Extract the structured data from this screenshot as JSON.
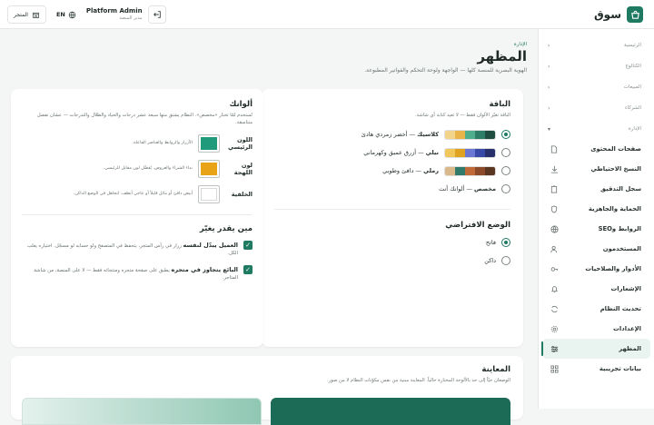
{
  "app": {
    "name": "سوق"
  },
  "topbar": {
    "user_name": "Platform Admin",
    "user_role": "مدير المنصة",
    "lang": "EN",
    "store_button": "المتجر"
  },
  "sidebar": {
    "sections": [
      {
        "label": "الرئيسية"
      },
      {
        "label": "الكتالوج"
      },
      {
        "label": "المبيعات"
      },
      {
        "label": "الشركاء"
      },
      {
        "label": "الإدارة"
      }
    ],
    "items": [
      {
        "label": "صفحات المحتوى",
        "icon": "file-icon"
      },
      {
        "label": "النسخ الاحتياطي",
        "icon": "download-icon"
      },
      {
        "label": "سجل التدقيق",
        "icon": "clipboard-icon"
      },
      {
        "label": "الحماية والجاهزية",
        "icon": "shield-icon"
      },
      {
        "label": "الروابط وSEO",
        "icon": "globe-icon"
      },
      {
        "label": "المستخدمون",
        "icon": "users-icon"
      },
      {
        "label": "الأدوار والصلاحيات",
        "icon": "key-icon"
      },
      {
        "label": "الإشعارات",
        "icon": "bell-icon"
      },
      {
        "label": "تحديث النظام",
        "icon": "refresh-icon"
      },
      {
        "label": "الإعدادات",
        "icon": "gear-icon"
      },
      {
        "label": "المظهر",
        "icon": "sliders-icon",
        "active": true
      },
      {
        "label": "بيانات تجريبية",
        "icon": "grid-icon"
      }
    ]
  },
  "page": {
    "breadcrumb": "الإدارة",
    "title": "المظهر",
    "subtitle": "الهوية البصرية للمنصة كلها — الواجهة ولوحة التحكم والفواتير المطبوعة."
  },
  "package": {
    "title": "الباقة",
    "hint": "الباقة تغيّر الألوان فقط — لا تعيد كتابة أي شاشة.",
    "options": [
      {
        "label": "كلاسيك",
        "desc": "أخضر زمردي هادئ",
        "selected": true,
        "colors": [
          "#1f4d40",
          "#2e7d66",
          "#4fae8c",
          "#e9b54a",
          "#f2d48a"
        ]
      },
      {
        "label": "نيلي",
        "desc": "أزرق عميق وكهرماني",
        "selected": false,
        "colors": [
          "#27306b",
          "#3849a8",
          "#6a78d4",
          "#e0a320",
          "#f2c75a"
        ]
      },
      {
        "label": "رملي",
        "desc": "دافئ وطوبي",
        "selected": false,
        "colors": [
          "#5a3520",
          "#8b4a2a",
          "#c06a3a",
          "#2f7a6a",
          "#d9b98a"
        ]
      },
      {
        "label": "مخصص",
        "desc": "ألوانك أنت",
        "selected": false,
        "colors": []
      }
    ]
  },
  "mode": {
    "title": "الوضع الافتراضي",
    "options": [
      {
        "label": "فاتح",
        "selected": true
      },
      {
        "label": "داكن",
        "selected": false
      }
    ]
  },
  "colors_card": {
    "title": "ألوانك",
    "hint": "تُستخدم لمّا تختار «مخصص». النظام يشتق منها سبعة عشر درجات والحياد والظلال والتدرجات — عشان تفضل متناسقة.",
    "rows": [
      {
        "label": "اللون الرئيسي",
        "desc": "الأزرار والروابط والعناصر الفاعلة.",
        "color": "#1f9a7a"
      },
      {
        "label": "لون اللهجة",
        "desc": "نداء الشراء والعروض. يُفضّل لون مقابل للرئيسي.",
        "color": "#e8a317"
      },
      {
        "label": "الخلفية",
        "desc": "أبيض دافئ أو مائل قليلاً أو عاجي أنظف. تُتجاهل في الوضع الداكن.",
        "color": "#ffffff"
      }
    ]
  },
  "who": {
    "title": "مين يقدر يغيّر",
    "items": [
      {
        "strong": "العميل يبدّل لنفسه",
        "text": "زرار في رأس المتجر، يتحفظ في المتصفح ولو حسابه لو مسجّل. اختياره يغلب الكل.",
        "checked": true
      },
      {
        "strong": "البائع يتجاوز في متجره",
        "text": "يطبق على صفحة متجره ومنتجاته فقط — لا على المنصة، من شاشة المتاجر.",
        "checked": true
      }
    ]
  },
  "preview": {
    "title": "المعاينة",
    "hint": "الوضعان حيّاً إلى حد بالألوحة المختارة حالياً. المعاينة مبنية من نفس مكوّنات النظام لا من صور."
  }
}
